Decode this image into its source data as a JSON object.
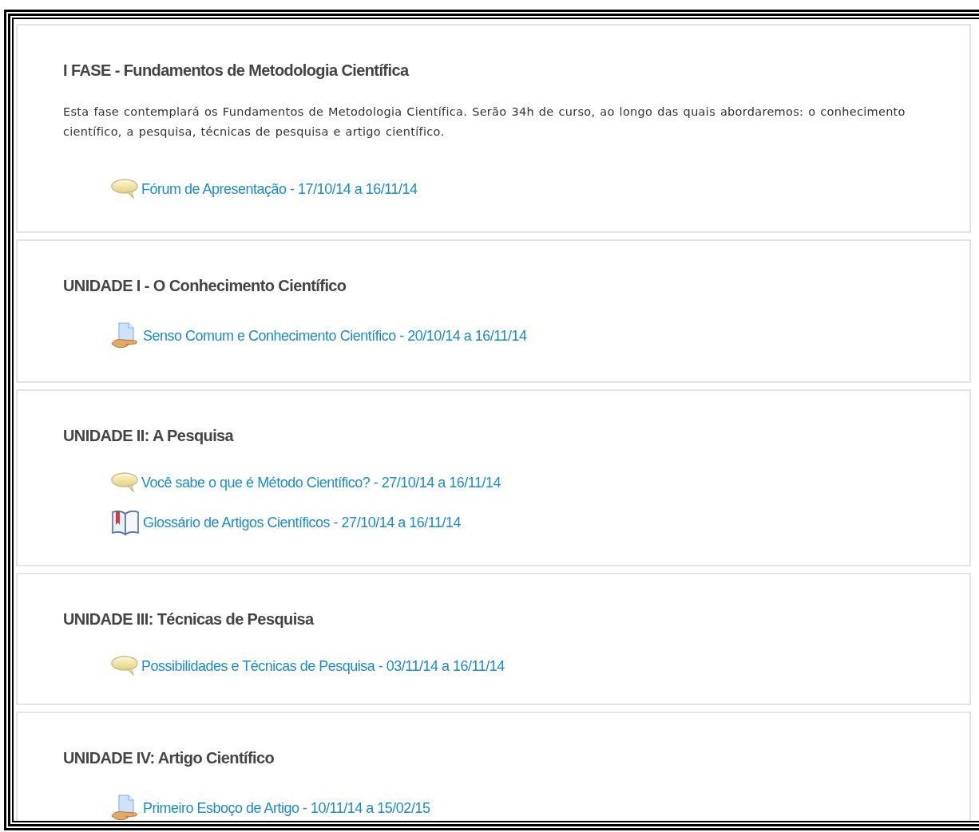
{
  "sections": [
    {
      "title": "I FASE - Fundamentos de Metodologia Científica",
      "summary": "Esta fase contemplará os Fundamentos de Metodologia Científica. Serão 34h de curso, ao longo das quais abordaremos: o conhecimento científico, a pesquisa, técnicas de pesquisa e artigo científico.",
      "activities": [
        {
          "kind": "forum",
          "label": "Fórum de Apresentação - 17/10/14 a 16/11/14"
        }
      ]
    },
    {
      "title": "UNIDADE I - O Conhecimento Científico",
      "activities": [
        {
          "kind": "assignment",
          "label": "Senso Comum e Conhecimento Científico - 20/10/14 a 16/11/14"
        }
      ]
    },
    {
      "title": "UNIDADE II: A Pesquisa",
      "activities": [
        {
          "kind": "forum",
          "label": "Você sabe o que é Método Científico? - 27/10/14 a 16/11/14"
        },
        {
          "kind": "glossary",
          "label": "Glossário de Artigos Científicos - 27/10/14 a 16/11/14"
        }
      ]
    },
    {
      "title": "UNIDADE III: Técnicas de Pesquisa",
      "activities": [
        {
          "kind": "forum",
          "label": "Possibilidades e Técnicas de Pesquisa - 03/11/14 a 16/11/14"
        }
      ]
    },
    {
      "title": "UNIDADE IV: Artigo Científico",
      "activities": [
        {
          "kind": "assignment",
          "label": "Primeiro Esboço de Artigo - 10/11/14 a 15/02/15"
        }
      ]
    }
  ]
}
